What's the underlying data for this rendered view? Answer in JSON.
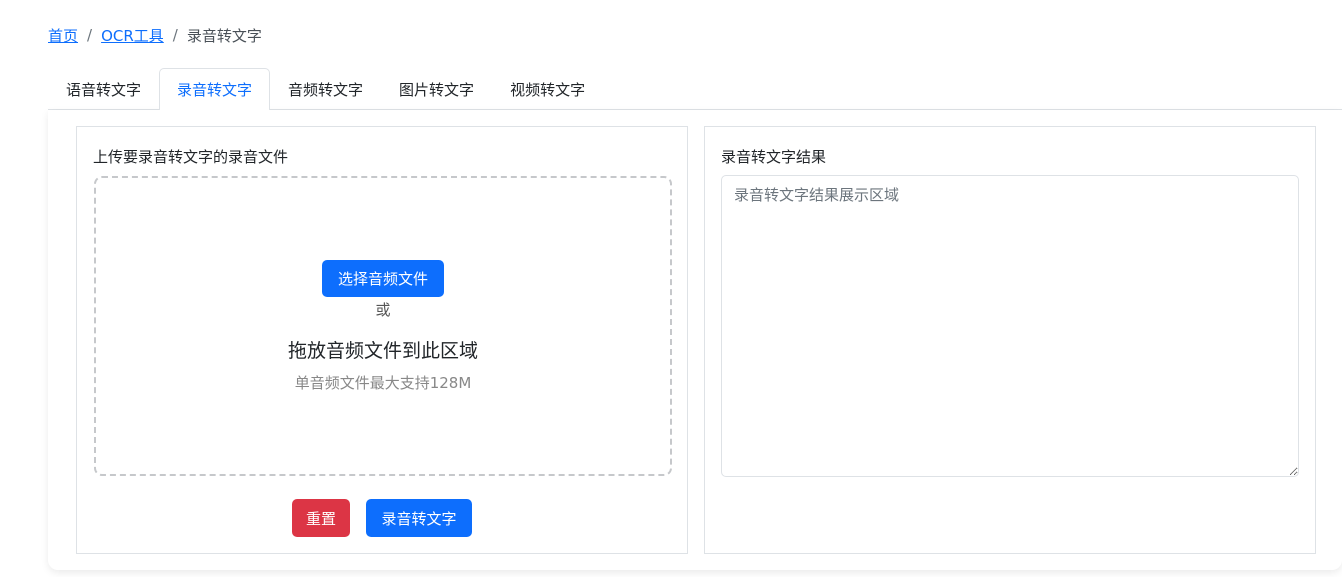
{
  "breadcrumb": {
    "home": "首页",
    "ocr_tools": "OCR工具",
    "current": "录音转文字",
    "separator": "/"
  },
  "tabs": [
    {
      "label": "语音转文字",
      "active": false
    },
    {
      "label": "录音转文字",
      "active": true
    },
    {
      "label": "音频转文字",
      "active": false
    },
    {
      "label": "图片转文字",
      "active": false
    },
    {
      "label": "视频转文字",
      "active": false
    }
  ],
  "upload": {
    "title": "上传要录音转文字的录音文件",
    "choose_button": "选择音频文件",
    "or_text": "或",
    "drop_text": "拖放音频文件到此区域",
    "limit_hint": "单音频文件最大支持128M"
  },
  "actions": {
    "reset_label": "重置",
    "convert_label": "录音转文字"
  },
  "result": {
    "title": "录音转文字结果",
    "placeholder": "录音转文字结果展示区域",
    "value": ""
  },
  "colors": {
    "primary": "#0d6efd",
    "danger": "#dc3545",
    "border": "#dee2e6"
  }
}
